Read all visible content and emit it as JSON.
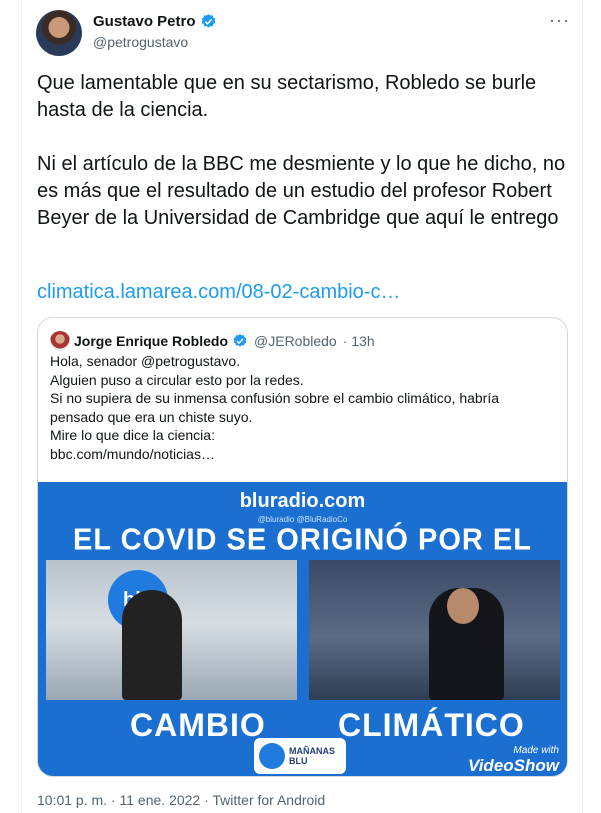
{
  "tweet": {
    "author_name": "Gustavo Petro",
    "author_handle": "@petrogustavo",
    "more_glyph": "···",
    "paragraph_1": "Que lamentable que en su sectarismo, Robledo se burle hasta de la ciencia.",
    "paragraph_2": "Ni el artículo de la BBC me desmiente y lo que he dicho, no es más que el resultado de un estudio del profesor Robert Beyer de la Universidad de Cambridge que aquí le entrego",
    "link": "climatica.lamarea.com/08-02-cambio-c…",
    "footer": "10:01 p. m. · 11 ene. 2022 · Twitter for Android"
  },
  "quote": {
    "author_name": "Jorge Enrique Robledo",
    "author_handle": "@JERobledo",
    "time": "· 13h",
    "lines": [
      "Hola, senador @petrogustavo.",
      "Alguien puso a circular esto por la redes.",
      "Si no supiera de su inmensa confusión sobre el cambio climático, habría",
      "pensado que era un chiste suyo.",
      "Mire lo que dice la ciencia:",
      "bbc.com/mundo/noticias…"
    ],
    "media": {
      "site": "bluradio.com",
      "social": "@bluradio   @BluRadioCo",
      "headline": "EL COVID SE ORIGINÓ POR EL",
      "logo_text": "blu",
      "word_left": "CAMBIO",
      "word_right": "CLIMÁTICO",
      "badge_line1": "MAÑANAS",
      "badge_line2": "BLU",
      "made_with": "Made with",
      "videoshow": "VideoShow"
    }
  },
  "colors": {
    "link": "#1d9bf0",
    "verified": "#1d9bf0",
    "media_blue": "#1a6fd1"
  }
}
